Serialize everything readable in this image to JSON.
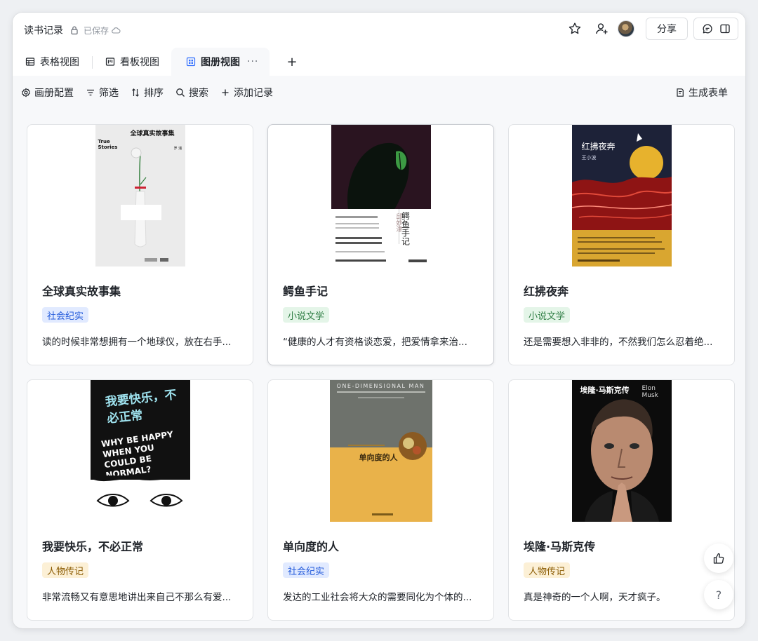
{
  "header": {
    "doc_title": "读书记录",
    "save_status": "已保存",
    "share_label": "分享"
  },
  "tabs": [
    {
      "label": "表格视图",
      "icon": "table-icon"
    },
    {
      "label": "看板视图",
      "icon": "kanban-icon"
    },
    {
      "label": "图册视图",
      "icon": "gallery-icon",
      "active": true,
      "more": "···"
    }
  ],
  "add_tab_label": "+",
  "toolbar": {
    "gallery_config": "画册配置",
    "filter": "筛选",
    "sort": "排序",
    "search": "搜索",
    "add_record": "添加记录",
    "generate_form": "生成表单"
  },
  "tag_colors": {
    "社会纪实": {
      "bg": "#e1eaff",
      "fg": "#245bdb"
    },
    "小说文学": {
      "bg": "#e4f5e8",
      "fg": "#2e7d43"
    },
    "人物传记": {
      "bg": "#fcf0d6",
      "fg": "#8a5a00"
    }
  },
  "books": [
    {
      "title": "全球真实故事集",
      "tag": "社会纪实",
      "desc": "读的时候非常想拥有一个地球仪，放在右手...",
      "cover": {
        "bg": "#ebebeb",
        "title": "全球真实故事集",
        "en": "True Stories",
        "author": "罗 浦"
      }
    },
    {
      "title": "鳄鱼手记",
      "tag": "小说文学",
      "desc": "“健康的人才有资格谈恋爱，把爱情拿来治...",
      "cover": {
        "bg": "#2a1420",
        "title": "鳄鱼手记",
        "author": "邱妙津"
      }
    },
    {
      "title": "红拂夜奔",
      "tag": "小说文学",
      "desc": "还是需要想入非非的，不然我们怎么忍着绝...",
      "cover": {
        "bg": "#1d2238",
        "title": "红拂夜奔",
        "author": "王小波"
      }
    },
    {
      "title": "我要快乐，不必正常",
      "tag": "人物传记",
      "desc": "非常流畅又有意思地讲出来自己不那么有爱...",
      "cover": {
        "bg": "#111111",
        "title": "我要快乐，不必正常",
        "en": "WHY BE HAPPY WHEN YOU COULD BE NORMAL?"
      }
    },
    {
      "title": "单向度的人",
      "tag": "社会纪实",
      "desc": "发达的工业社会将大众的需要同化为个体的...",
      "cover": {
        "bg": "#6e726c",
        "title": "单向度的人",
        "en": "ONE-DIMENSIONAL MAN"
      }
    },
    {
      "title": "埃隆·马斯克传",
      "tag": "人物传记",
      "desc": "真是神奇的一个人啊，天才疯子。",
      "cover": {
        "bg": "#0c0c0c",
        "title": "埃隆·马斯克传",
        "en": "Elon Musk"
      }
    }
  ],
  "help_label": "?"
}
